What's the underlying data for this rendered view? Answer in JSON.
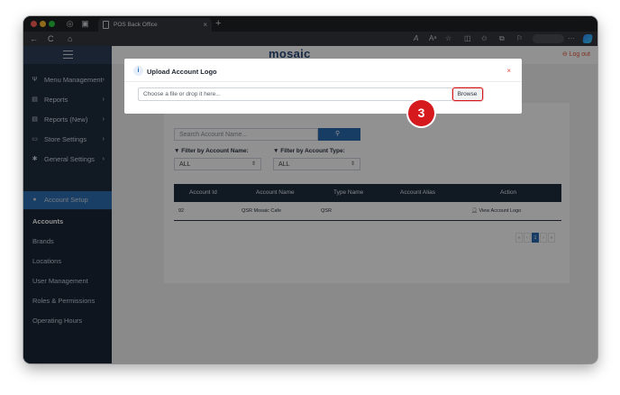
{
  "browser": {
    "tab_title": "POS Back Office",
    "tab_close": "×",
    "new_tab": "+",
    "nav": {
      "back": "←",
      "reload": "C",
      "home": "⌂"
    },
    "toolbar_icons": [
      "read-aloud",
      "translate",
      "favorite",
      "split-screen",
      "favorites",
      "collections",
      "extensions",
      "more"
    ]
  },
  "app": {
    "brand": "mosaic",
    "logout": "⊖ Log out"
  },
  "sidebar": {
    "items": [
      {
        "icon": "utensils-icon",
        "glyph": "Ψ",
        "label": "Menu Management",
        "chevron": "›"
      },
      {
        "icon": "file-icon",
        "glyph": "▤",
        "label": "Reports",
        "chevron": "›"
      },
      {
        "icon": "file-icon",
        "glyph": "▤",
        "label": "Reports (New)",
        "chevron": "›"
      },
      {
        "icon": "store-icon",
        "glyph": "▭",
        "label": "Store Settings",
        "chevron": "›"
      },
      {
        "icon": "gear-icon",
        "glyph": "✱",
        "label": "General Settings",
        "chevron": "›"
      },
      {
        "icon": "user-icon",
        "glyph": "●",
        "label": "Account Setup",
        "chevron": ""
      }
    ],
    "sub_items": [
      "Accounts",
      "Brands",
      "Locations",
      "User Management",
      "Roles & Permissions",
      "Operating Hours"
    ]
  },
  "page": {
    "search_placeholder": "Search Account Name...",
    "search_icon": "⚲",
    "filter_name_label": "▼ Filter by Account Name:",
    "filter_type_label": "▼ Filter by Account Type:",
    "filter_name_value": "ALL",
    "filter_type_value": "ALL",
    "select_arrow": "⇕",
    "table_headers": [
      "Account Id",
      "Account Name",
      "Type Name",
      "Account Alias",
      "Action"
    ],
    "rows": [
      {
        "id": "92",
        "name": "QSR Mosaic Cafe",
        "type": "QSR",
        "alias": "",
        "action": "View Account Logo"
      }
    ],
    "pager": [
      "«",
      "‹",
      "1",
      "›",
      "»"
    ]
  },
  "modal": {
    "info_glyph": "i",
    "title": "Upload Account Logo",
    "close": "×",
    "file_placeholder": "Choose a file or drop it here...",
    "browse_label": "Browse"
  },
  "annotation": {
    "step": "3"
  },
  "colors": {
    "sidebar_bg": "#1f2c3f",
    "accent": "#2b6cb0",
    "highlight_red": "#d6191d"
  }
}
